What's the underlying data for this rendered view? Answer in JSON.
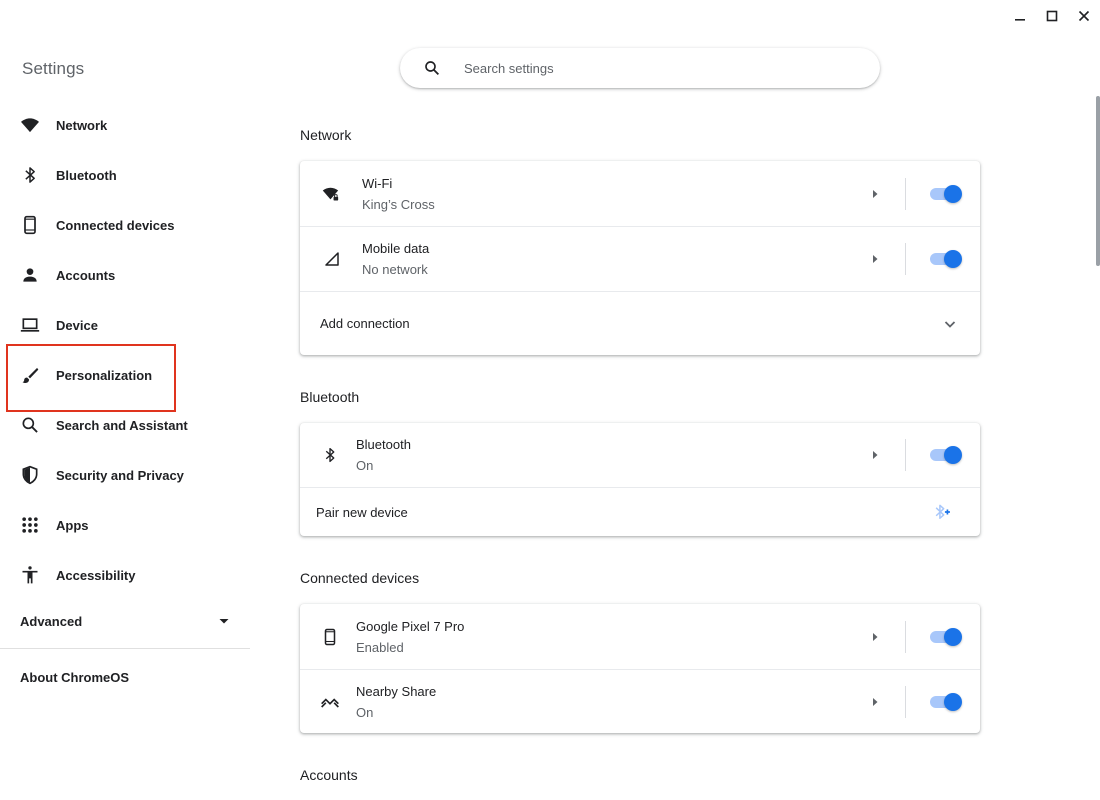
{
  "window": {
    "minimize_icon": "minimize-icon",
    "maximize_icon": "maximize-icon",
    "close_icon": "close-icon"
  },
  "sidebar": {
    "title": "Settings",
    "items": [
      {
        "label": "Network",
        "icon": "wifi-icon"
      },
      {
        "label": "Bluetooth",
        "icon": "bluetooth-icon"
      },
      {
        "label": "Connected devices",
        "icon": "phone-icon"
      },
      {
        "label": "Accounts",
        "icon": "person-icon"
      },
      {
        "label": "Device",
        "icon": "laptop-icon"
      },
      {
        "label": "Personalization",
        "icon": "brush-icon",
        "highlighted": true
      },
      {
        "label": "Search and Assistant",
        "icon": "search-icon"
      },
      {
        "label": "Security and Privacy",
        "icon": "shield-icon"
      },
      {
        "label": "Apps",
        "icon": "apps-grid-icon"
      },
      {
        "label": "Accessibility",
        "icon": "accessibility-icon"
      }
    ],
    "advanced_label": "Advanced",
    "about_label": "About ChromeOS"
  },
  "search": {
    "placeholder": "Search settings"
  },
  "sections": {
    "network": {
      "title": "Network",
      "wifi": {
        "title": "Wi-Fi",
        "subtitle": "King’s Cross",
        "enabled": true
      },
      "mobile": {
        "title": "Mobile data",
        "subtitle": "No network",
        "enabled": true
      },
      "add_connection": "Add connection"
    },
    "bluetooth": {
      "title": "Bluetooth",
      "bluetooth": {
        "title": "Bluetooth",
        "subtitle": "On",
        "enabled": true
      },
      "pair": "Pair new device"
    },
    "connected": {
      "title": "Connected devices",
      "phone": {
        "title": "Google Pixel 7 Pro",
        "subtitle": "Enabled",
        "enabled": true
      },
      "nearby": {
        "title": "Nearby Share",
        "subtitle": "On",
        "enabled": true
      }
    },
    "accounts": {
      "title": "Accounts"
    }
  },
  "colors": {
    "accent": "#1a73e8",
    "toggle_track": "#a8c7fa",
    "highlight_box": "#e0341e",
    "text_primary": "#202124",
    "text_secondary": "#5f6368"
  }
}
